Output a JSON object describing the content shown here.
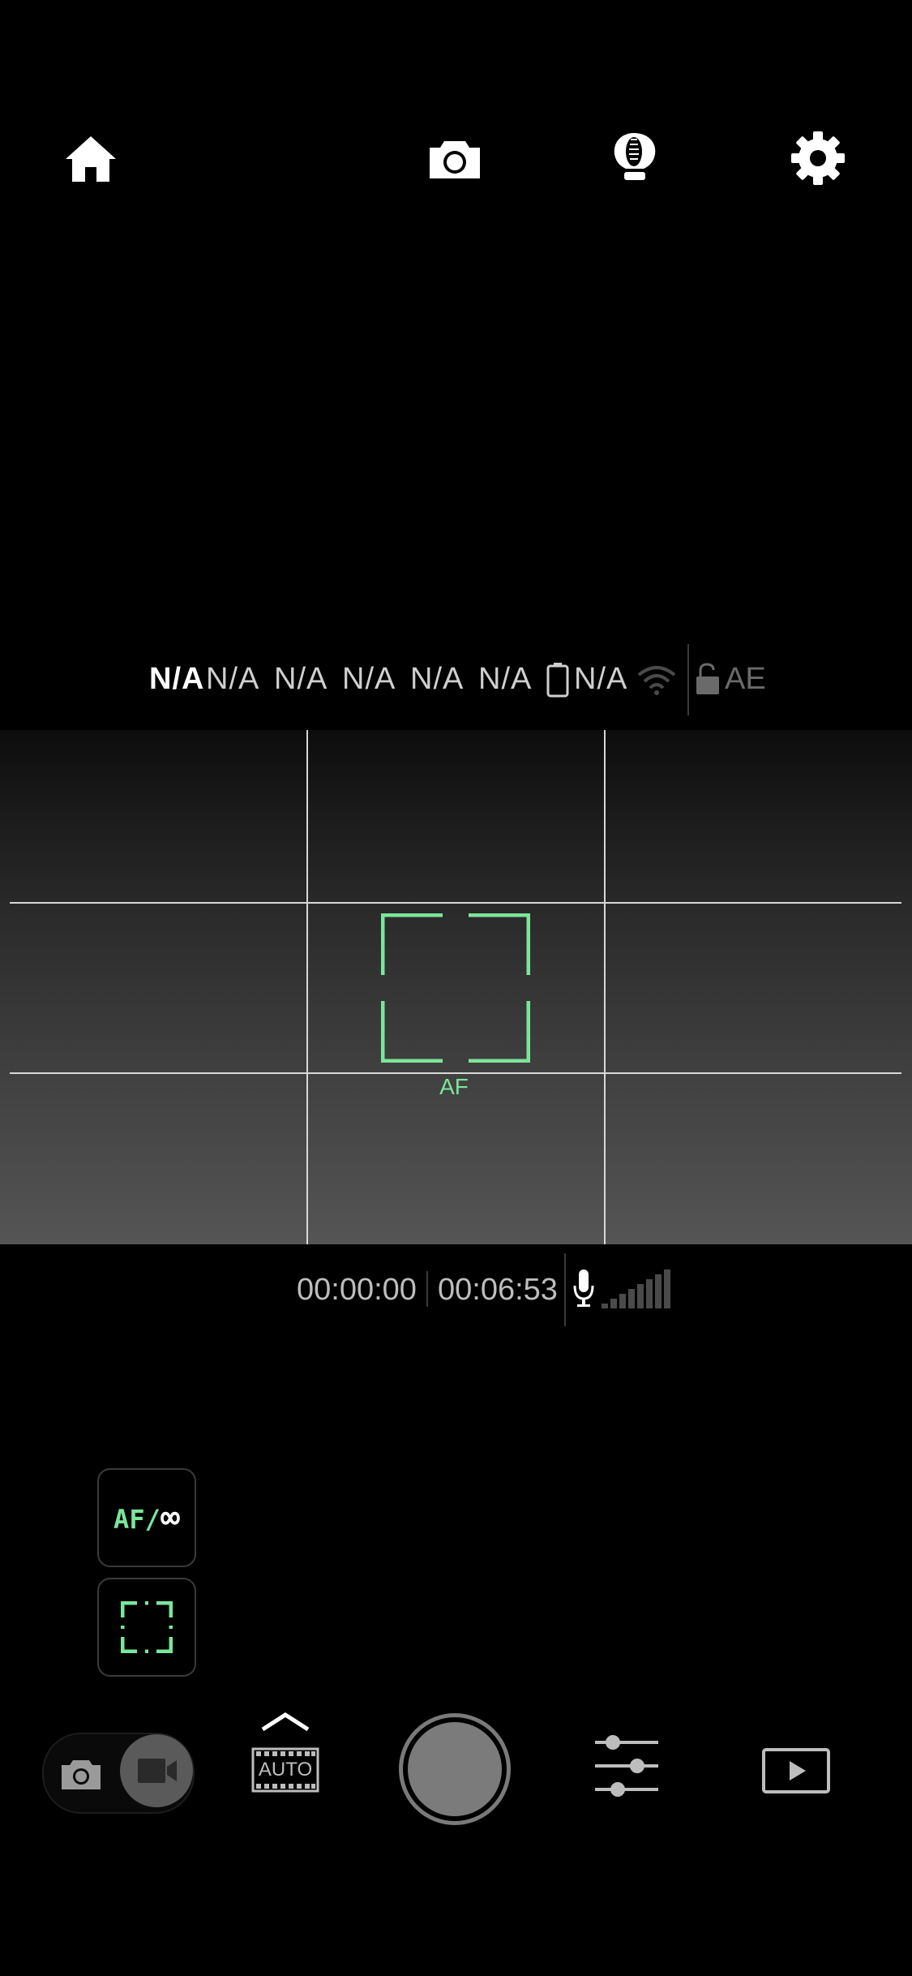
{
  "top_bar": {
    "icons": [
      "home-icon",
      "camera-icon",
      "stabilizer-icon",
      "settings-icon"
    ]
  },
  "status": {
    "items": [
      "N/A",
      "N/A",
      "N/A",
      "N/A",
      "N/A",
      "N/A"
    ],
    "battery_value": "N/A",
    "ae_label": "AE"
  },
  "viewfinder": {
    "focus_label": "AF",
    "accent_color": "#7be59a"
  },
  "recording": {
    "elapsed": "00:00:00",
    "remaining": "00:06:53"
  },
  "side_controls": {
    "focus_mode_af": "AF",
    "focus_mode_sep": "/",
    "focus_mode_inf": "∞"
  },
  "bottom_bar": {
    "scene_mode": "AUTO"
  }
}
